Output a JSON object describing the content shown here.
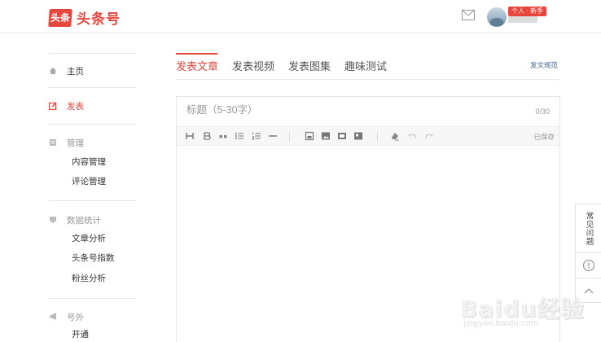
{
  "header": {
    "logo_badge": "头条",
    "logo_text": "头条号",
    "user_badge": "个人 · 新手"
  },
  "sidebar": {
    "home": "主页",
    "publish": "发表",
    "manage": {
      "label": "管理",
      "items": [
        "内容管理",
        "评论管理"
      ]
    },
    "stats": {
      "label": "数据统计",
      "items": [
        "文章分析",
        "头条号指数",
        "粉丝分析"
      ]
    },
    "extra": {
      "label": "号外",
      "items": [
        "开通"
      ]
    }
  },
  "tabs": {
    "items": [
      "发表文章",
      "发表视频",
      "发表图集",
      "趣味测试"
    ],
    "active": "发表文章",
    "rules_link": "发文规范"
  },
  "editor": {
    "title_placeholder": "标题（5-30字）",
    "title_count": "0/30",
    "saved_status": "已保存",
    "toolbar_icons": [
      "heading-icon",
      "bold-icon",
      "quote-icon",
      "bulleted-list-icon",
      "numbered-list-icon",
      "divider-icon",
      "document-icon",
      "image-icon",
      "video-icon",
      "gallery-icon",
      "clear-format-icon",
      "undo-icon",
      "redo-icon"
    ]
  },
  "float": {
    "faq": "常见问题"
  },
  "watermark": {
    "text": "Baidu经验",
    "url": "jingyan.baidu.com"
  },
  "colors": {
    "brand": "#e7463c",
    "link": "#406599"
  }
}
